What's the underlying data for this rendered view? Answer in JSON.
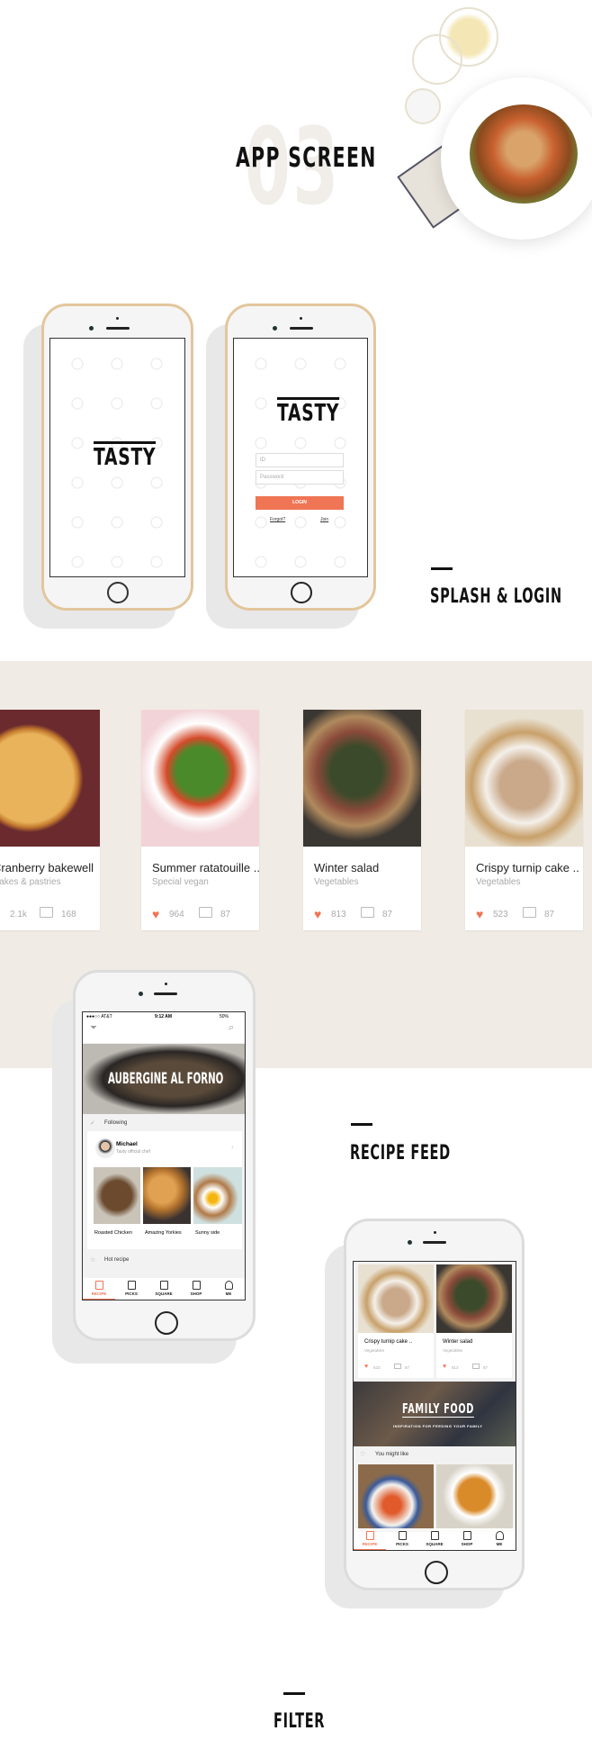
{
  "header": {
    "number": "03",
    "title": "APP SCREEN"
  },
  "sections": {
    "splash_login": "SPLASH & LOGIN",
    "recipe_feed": "RECIPE FEED",
    "filter": "FILTER"
  },
  "brand": {
    "logo": "TASTY",
    "accent": "#f07554",
    "band_bg": "#f0ebe5"
  },
  "login": {
    "id_placeholder": "ID",
    "password_placeholder": "Password",
    "login_button": "LOGIN",
    "forgot": "Forgot?",
    "join": "Join"
  },
  "cards": [
    {
      "title": "Cranberry bakewell",
      "subtitle": "Cakes & pastries",
      "likes": "2.1k",
      "comments": "168"
    },
    {
      "title": "Summer ratatouille ..",
      "subtitle": "Special vegan",
      "likes": "964",
      "comments": "87"
    },
    {
      "title": "Winter salad",
      "subtitle": "Vegetables",
      "likes": "813",
      "comments": "87"
    },
    {
      "title": "Crispy turnip cake ..",
      "subtitle": "Vegetables",
      "likes": "523",
      "comments": "87"
    }
  ],
  "feed": {
    "status": {
      "carrier": "●●●○○ AT&T",
      "time": "9:12 AM",
      "battery": "50%"
    },
    "hero": "AUBERGINE AL FORNO",
    "following_label": "Following",
    "chef": {
      "name": "Michael",
      "role": "Tasty official chef"
    },
    "recipes": [
      "Roasted Chicken",
      "Amazing Yorkies",
      "Sunny side"
    ],
    "hot_label": "Hot recipe"
  },
  "feed2": {
    "cards": [
      {
        "title": "Crispy turnip cake ..",
        "subtitle": "Vegetables",
        "likes": "523",
        "comments": "87"
      },
      {
        "title": "Winter salad",
        "subtitle": "Vegetables",
        "likes": "813",
        "comments": "87"
      }
    ],
    "banner_title": "FAMILY FOOD",
    "banner_sub": "INSPIRATION FOR FEEDING YOUR FAMILY",
    "might_like": "You might like"
  },
  "tabs": [
    "RECIPE",
    "PICKS",
    "SQUARE",
    "SHOP",
    "ME"
  ]
}
